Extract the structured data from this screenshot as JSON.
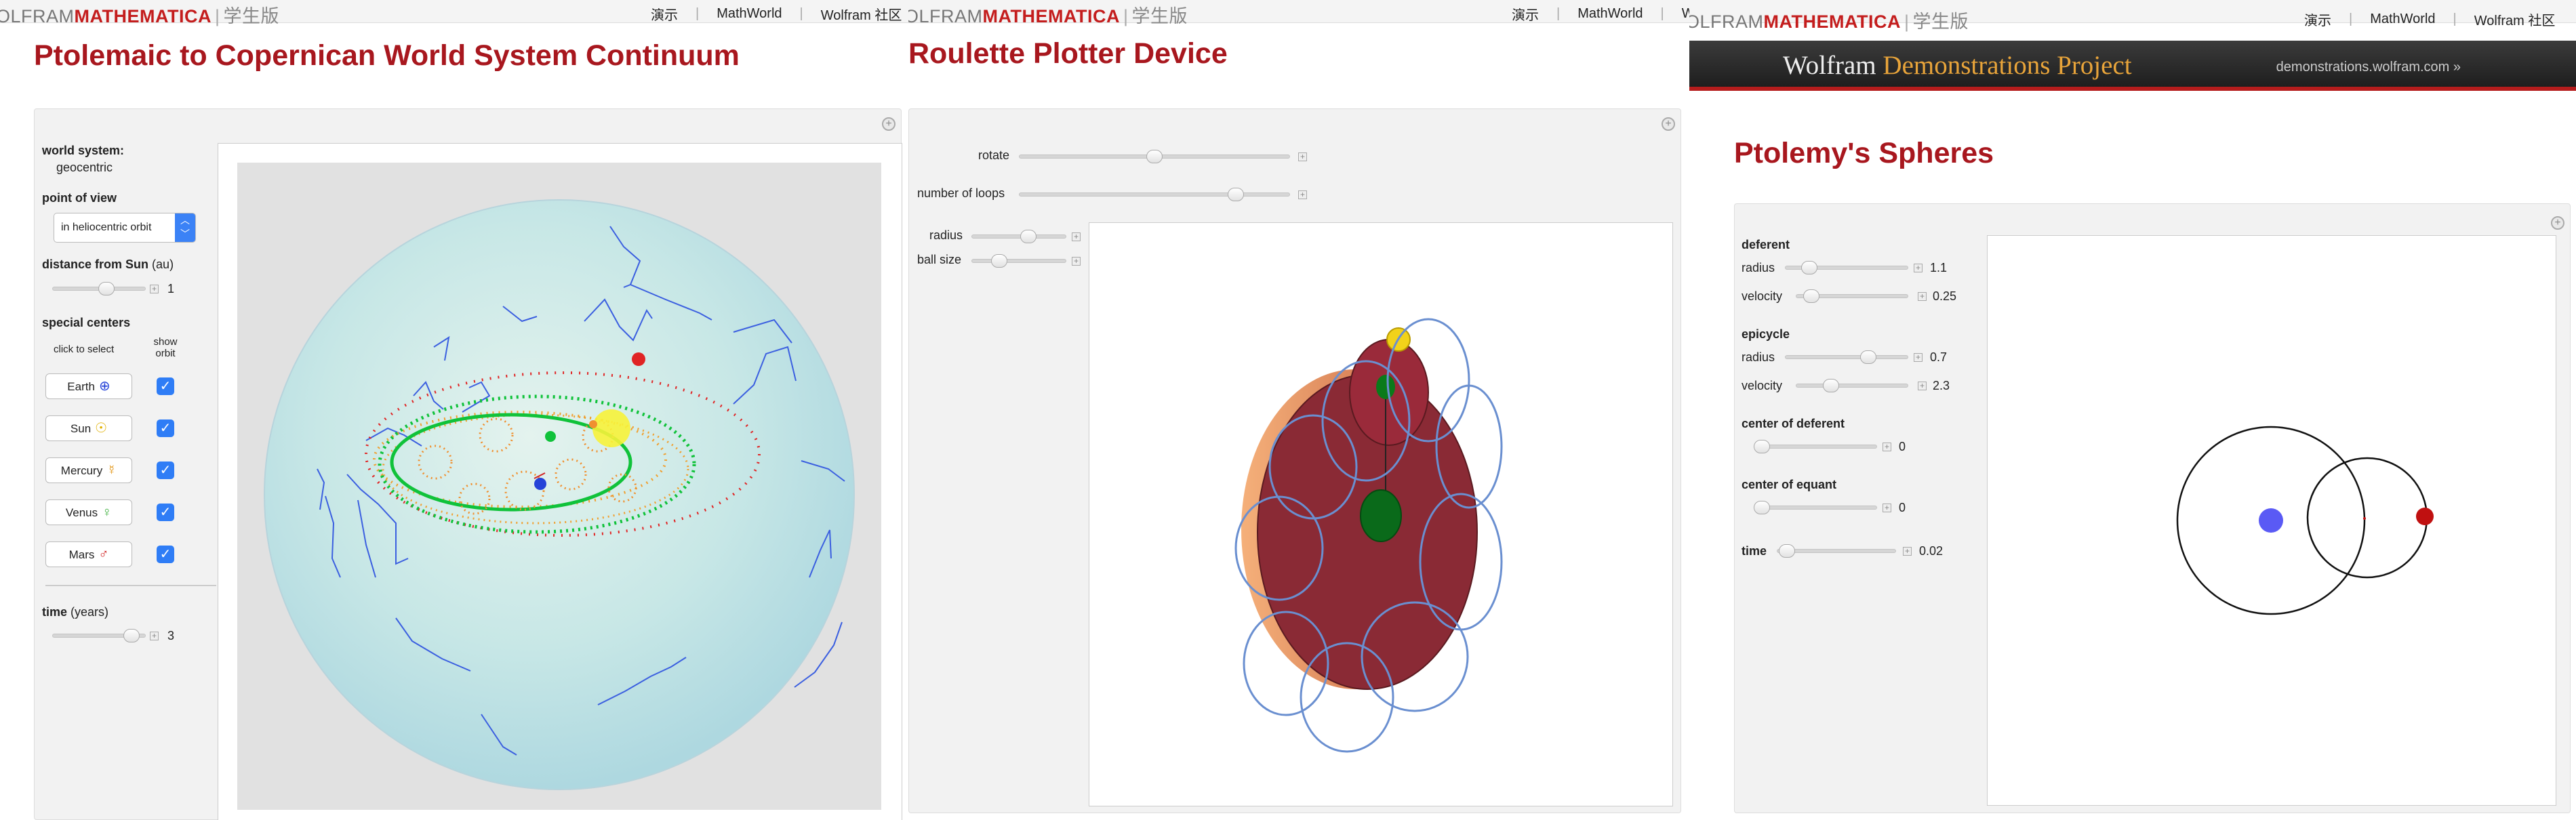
{
  "panel1": {
    "logo": {
      "w": "OLFRAM",
      "m": "MATHEMATICA",
      "sep": "|",
      "ed": "学生版"
    },
    "nav": [
      "演示",
      "MathWorld",
      "Wolfram 社区"
    ],
    "title": "Ptolemaic to Copernican World System Continuum",
    "controls": {
      "world_system_label": "world system:",
      "world_system_value": "geocentric",
      "point_of_view_label": "point of view",
      "point_of_view_value": "in heliocentric orbit",
      "distance_label": "distance from Sun",
      "distance_unit": "(au)",
      "distance_value": "1",
      "distance_level": 0.6,
      "special_centers_label": "special centers",
      "click_to_select": "click to select",
      "show_orbit": "show orbit",
      "centers": [
        {
          "name": "Earth",
          "symbol": "⊕",
          "color": "#2643d8",
          "checked": "✓"
        },
        {
          "name": "Sun",
          "symbol": "☉",
          "color": "#e0b000",
          "checked": "✓"
        },
        {
          "name": "Mercury",
          "symbol": "☿",
          "color": "#e08c00",
          "checked": "✓"
        },
        {
          "name": "Venus",
          "symbol": "♀",
          "color": "#3cb03c",
          "checked": "✓"
        },
        {
          "name": "Mars",
          "symbol": "♂",
          "color": "#d02020",
          "checked": "✓"
        }
      ],
      "time_label": "time",
      "time_unit": "(years)",
      "time_value": "3",
      "time_level": 0.92
    },
    "sphere_colors": {
      "sphere": "#bfe3e6",
      "earth_orbit": "#10c23a",
      "mars_orbit": "#e02424",
      "mercury_orbit": "#f0a030",
      "constellation": "#3b5fe0"
    }
  },
  "panel2": {
    "logo": {
      "w": "OLFRAM",
      "m": "MATHEMATICA",
      "sep": "|",
      "ed": "学生版"
    },
    "nav": [
      "演示",
      "MathWorld",
      "W"
    ],
    "title": "Roulette Plotter Device",
    "controls": {
      "rotate_label": "rotate",
      "rotate_level": 0.5,
      "loops_label": "number of loops",
      "loops_level": 0.82,
      "radius_label": "radius",
      "radius_level": 0.62,
      "ball_label": "ball size",
      "ball_level": 0.25
    }
  },
  "panel3": {
    "logo": {
      "w": "OLFRAM",
      "m": "MATHEMATICA",
      "sep": "|",
      "ed": "学生版"
    },
    "nav": [
      "演示",
      "MathWorld",
      "Wolfram 社区"
    ],
    "banner_left": "Wolfram",
    "banner_highlight": "Demonstrations Project",
    "banner_right": "demonstrations.wolfram.com »",
    "title": "Ptolemy's Spheres",
    "controls": {
      "deferent_label": "deferent",
      "def_radius_label": "radius",
      "def_radius_value": "1.1",
      "def_radius_level": 0.15,
      "def_velocity_label": "velocity",
      "def_velocity_value": "0.25",
      "def_velocity_level": 0.08,
      "epicycle_label": "epicycle",
      "epi_radius_label": "radius",
      "epi_radius_value": "0.7",
      "epi_radius_level": 0.7,
      "epi_velocity_label": "velocity",
      "epi_velocity_value": "2.3",
      "epi_velocity_level": 0.28,
      "center_deferent_label": "center of deferent",
      "center_deferent_value": "0",
      "center_deferent_level": 0.0,
      "center_equant_label": "center of equant",
      "center_equant_value": "0",
      "center_equant_level": 0.0,
      "time_label": "time",
      "time_value": "0.02",
      "time_level": 0.02
    }
  }
}
